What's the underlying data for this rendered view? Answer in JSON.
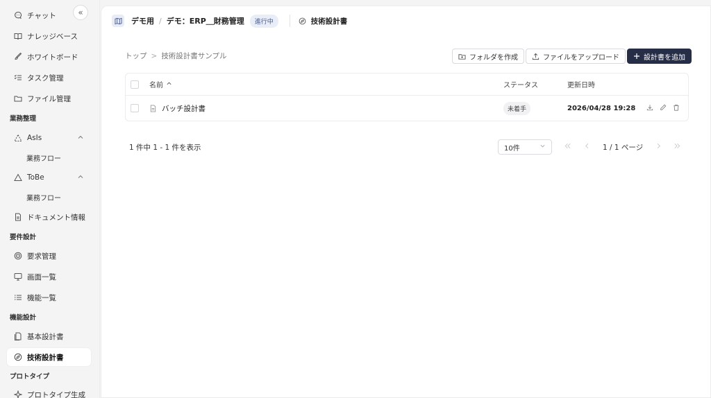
{
  "sidebar": {
    "items": [
      {
        "label": "チャット",
        "icon": "chat-icon"
      },
      {
        "label": "ナレッジベース",
        "icon": "book-icon"
      },
      {
        "label": "ホワイトボード",
        "icon": "brush-icon"
      },
      {
        "label": "タスク管理",
        "icon": "checklist-icon"
      },
      {
        "label": "ファイル管理",
        "icon": "folder-icon"
      }
    ],
    "sections": {
      "business": "業務整理",
      "requirements": "要件設計",
      "function": "機能設計",
      "prototype": "プロトタイプ"
    },
    "asis": {
      "label": "AsIs",
      "sub": "業務フロー"
    },
    "tobe": {
      "label": "ToBe",
      "sub": "業務フロー"
    },
    "document_info": "ドキュメント情報",
    "req_items": [
      {
        "label": "要求管理",
        "icon": "target-icon"
      },
      {
        "label": "画面一覧",
        "icon": "monitor-icon"
      },
      {
        "label": "機能一覧",
        "icon": "list-icon"
      }
    ],
    "func_items": [
      {
        "label": "基本設計書",
        "icon": "document-icon"
      },
      {
        "label": "技術設計書",
        "icon": "compass-icon"
      }
    ],
    "proto_item": "プロトタイプ生成",
    "collapse_icon": "«"
  },
  "header": {
    "project": "デモ用",
    "separator": "/",
    "subproject": "デモ：ERP＿財務管理",
    "status": "進行中",
    "current": "技術設計書"
  },
  "breadcrumb": {
    "root": "トップ",
    "sep": ">",
    "current": "技術設計書サンプル"
  },
  "actions": {
    "create_folder": "フォルダを作成",
    "upload": "ファイルをアップロード",
    "add": "設計書を追加"
  },
  "table": {
    "headers": {
      "name": "名前",
      "sort": "^",
      "status": "ステータス",
      "updated": "更新日時"
    },
    "rows": [
      {
        "name": "バッチ設計書",
        "status": "未着手",
        "updated": "2026/04/28 19:28"
      }
    ]
  },
  "pagination": {
    "summary": "1 件中 1 - 1 件を表示",
    "page_size": "10件",
    "page": "1 / 1 ページ"
  },
  "colors": {
    "primary": "#262d47",
    "sidebar_bg": "#f4f4f5",
    "status_bg": "#e9edf7"
  }
}
